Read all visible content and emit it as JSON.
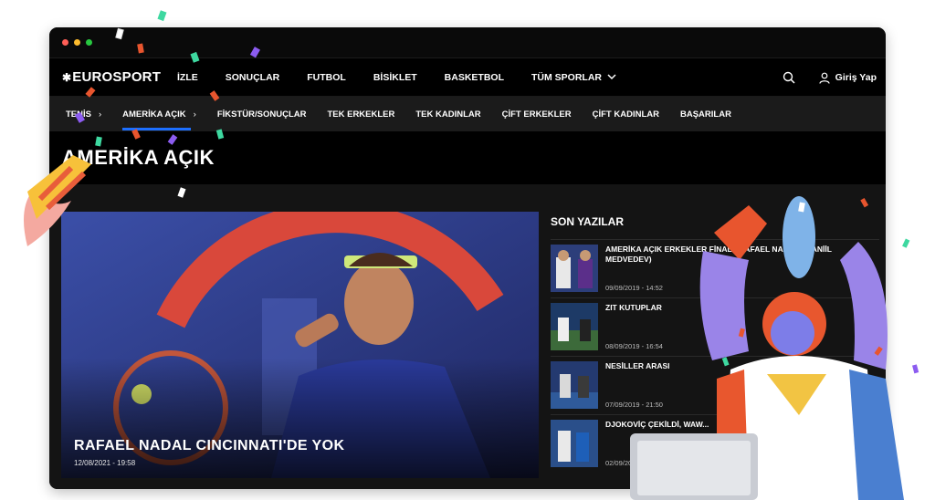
{
  "brand": {
    "logo_text": "EUROSPORT"
  },
  "nav": {
    "items": [
      {
        "label": "İZLE"
      },
      {
        "label": "SONUÇLAR"
      },
      {
        "label": "FUTBOL"
      },
      {
        "label": "BİSİKLET"
      },
      {
        "label": "BASKETBOL"
      },
      {
        "label": "TÜM SPORLAR"
      }
    ],
    "login_label": "Giriş Yap"
  },
  "subnav": {
    "items": [
      {
        "label": "TENİS"
      },
      {
        "label": "AMERİKA AÇIK"
      },
      {
        "label": "FİKSTÜR/SONUÇLAR"
      },
      {
        "label": "TEK ERKEKLER"
      },
      {
        "label": "TEK KADINLAR"
      },
      {
        "label": "ÇİFT ERKEKLER"
      },
      {
        "label": "ÇİFT KADINLAR"
      },
      {
        "label": "BAŞARILAR"
      }
    ]
  },
  "page": {
    "title": "AMERİKA AÇIK"
  },
  "hero": {
    "title": "RAFAEL NADAL CINCINNATI'DE YOK",
    "date": "12/08/2021 - 19:58"
  },
  "sidebar": {
    "title": "SON YAZILAR",
    "articles": [
      {
        "title": "AMERİKA AÇIK ERKEKLER FİNALİ: RAFAEL NADAL - DANİİL MEDVEDEV)",
        "date": "09/09/2019 - 14:52"
      },
      {
        "title": "ZIT KUTUPLAR",
        "date": "08/09/2019 - 16:54"
      },
      {
        "title": "NESİLLER ARASI",
        "date": "07/09/2019 - 21:50"
      },
      {
        "title": "DJOKOVİÇ ÇEKİLDİ, WAW...",
        "date": "02/09/2019 - ..."
      }
    ]
  },
  "colors": {
    "accent": "#1d6fff",
    "background": "#000000",
    "subnav_bg": "#1b1b1b",
    "dot_red": "#ff5f57",
    "dot_yellow": "#febc2e",
    "dot_green": "#28c840"
  }
}
